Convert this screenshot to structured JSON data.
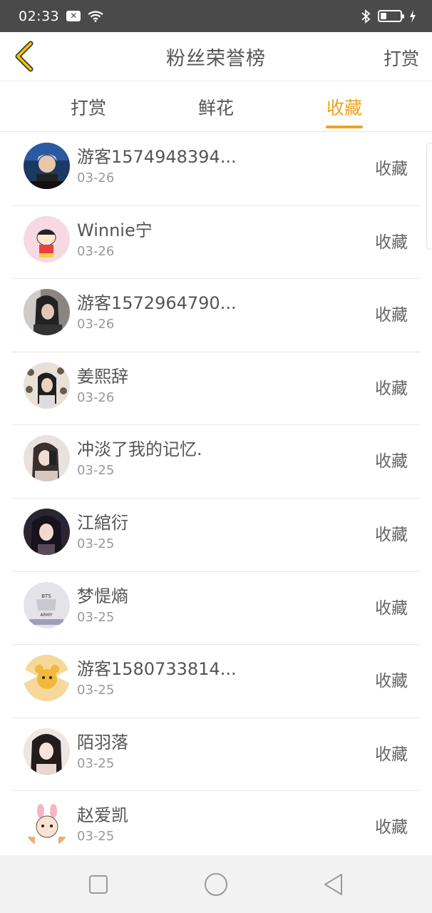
{
  "status_bar": {
    "time": "02:33",
    "icons": [
      "notification-x-icon",
      "wifi-icon",
      "bluetooth-icon",
      "battery-icon",
      "charging-icon"
    ],
    "battery_level": 0.3
  },
  "header": {
    "title": "粉丝荣誉榜",
    "action": "打赏",
    "accent_color": "#f0a21e"
  },
  "tabs": [
    {
      "label": "打赏",
      "active": false
    },
    {
      "label": "鲜花",
      "active": false
    },
    {
      "label": "收藏",
      "active": true
    }
  ],
  "fans": [
    {
      "name": "游客1574948394...",
      "date": "03-26",
      "action": "收藏",
      "avatar": "avatar-blue"
    },
    {
      "name": "Winnie宁",
      "date": "03-26",
      "action": "收藏",
      "avatar": "avatar-pink-cartoon"
    },
    {
      "name": "游客1572964790...",
      "date": "03-26",
      "action": "收藏",
      "avatar": "avatar-dark"
    },
    {
      "name": "姜熙辞",
      "date": "03-26",
      "action": "收藏",
      "avatar": "avatar-collage"
    },
    {
      "name": "冲淡了我的记忆.",
      "date": "03-25",
      "action": "收藏",
      "avatar": "avatar-selfie"
    },
    {
      "name": "江綰衍",
      "date": "03-25",
      "action": "收藏",
      "avatar": "avatar-portrait"
    },
    {
      "name": "梦惿熵",
      "date": "03-25",
      "action": "收藏",
      "avatar": "avatar-bts"
    },
    {
      "name": "游客1580733814...",
      "date": "03-25",
      "action": "收藏",
      "avatar": "avatar-cartoon-bear"
    },
    {
      "name": "陌羽落",
      "date": "03-25",
      "action": "收藏",
      "avatar": "avatar-girl"
    },
    {
      "name": "赵爱凯",
      "date": "03-25",
      "action": "收藏",
      "avatar": "avatar-bunny"
    }
  ],
  "nav_bar": {
    "buttons": [
      "recents-square-icon",
      "home-circle-icon",
      "back-triangle-icon"
    ]
  }
}
